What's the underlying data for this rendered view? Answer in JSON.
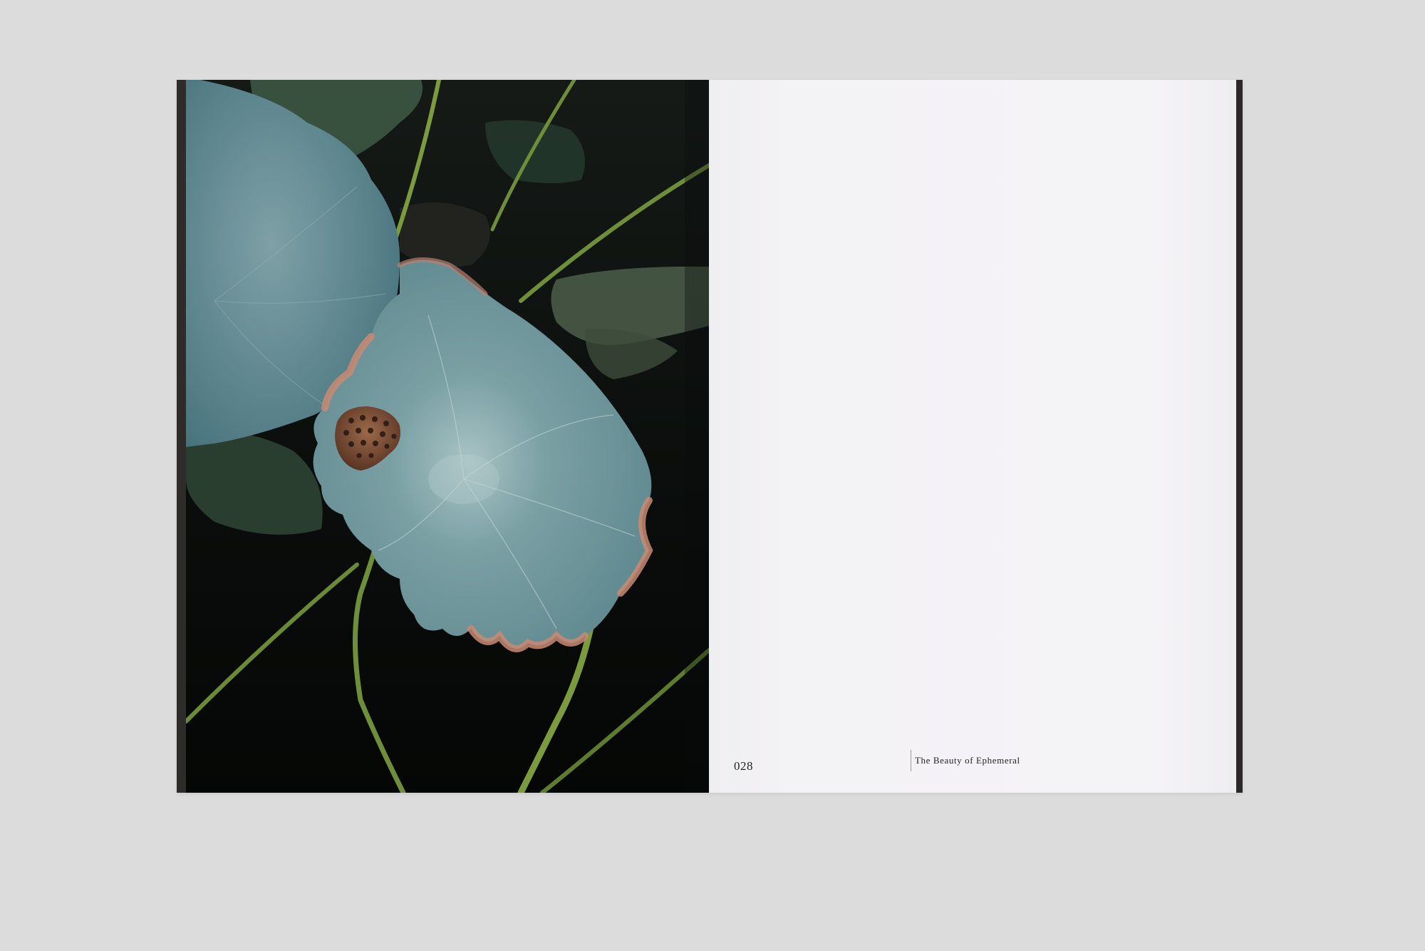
{
  "spread": {
    "left_page": {
      "photo": {
        "subject": "lotus-leaves-with-seed-pod",
        "colors": {
          "background": "#0a0c0b",
          "leaf": "#5e8a94",
          "leaf_highlight": "#8fb3b8",
          "stem": "#6f8e3a",
          "pod": "#7a4a33",
          "decay_edge": "#c88a72"
        }
      }
    },
    "right_page": {
      "folio": "028",
      "running_title": "The Beauty of Ephemeral"
    }
  }
}
